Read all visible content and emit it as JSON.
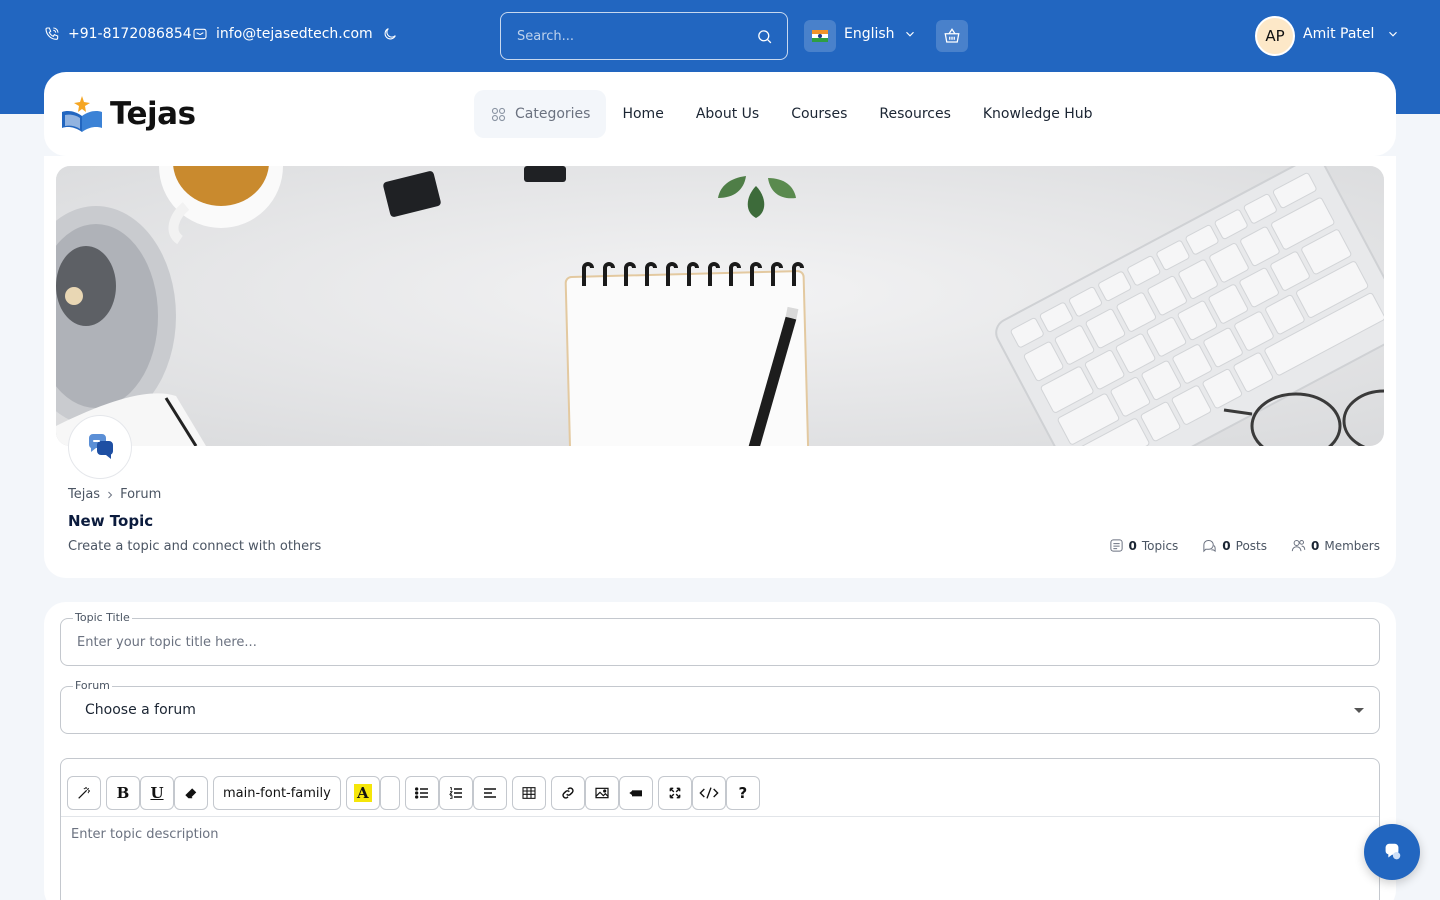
{
  "topbar": {
    "phone": "+91-8172086854",
    "email": "info@tejasedtech.com",
    "search_placeholder": "Search...",
    "language": "English",
    "user_initials": "AP",
    "user_name": "Amit Patel"
  },
  "brand": {
    "name": "Tejas"
  },
  "nav": {
    "categories": "Categories",
    "items": [
      "Home",
      "About Us",
      "Courses",
      "Resources",
      "Knowledge Hub"
    ]
  },
  "header": {
    "breadcrumb": [
      "Tejas",
      "Forum"
    ],
    "title": "New Topic",
    "subtitle": "Create a topic and connect with others",
    "stats": {
      "topics_count": "0",
      "topics_label": "Topics",
      "posts_count": "0",
      "posts_label": "Posts",
      "members_count": "0",
      "members_label": "Members"
    }
  },
  "form": {
    "title_label": "Topic Title",
    "title_placeholder": "Enter your topic title here...",
    "forum_label": "Forum",
    "forum_value": "Choose a forum",
    "font_family": "main-font-family",
    "description_placeholder": "Enter topic description"
  },
  "colors": {
    "primary": "#2266c0",
    "background": "#f3f6fa"
  }
}
